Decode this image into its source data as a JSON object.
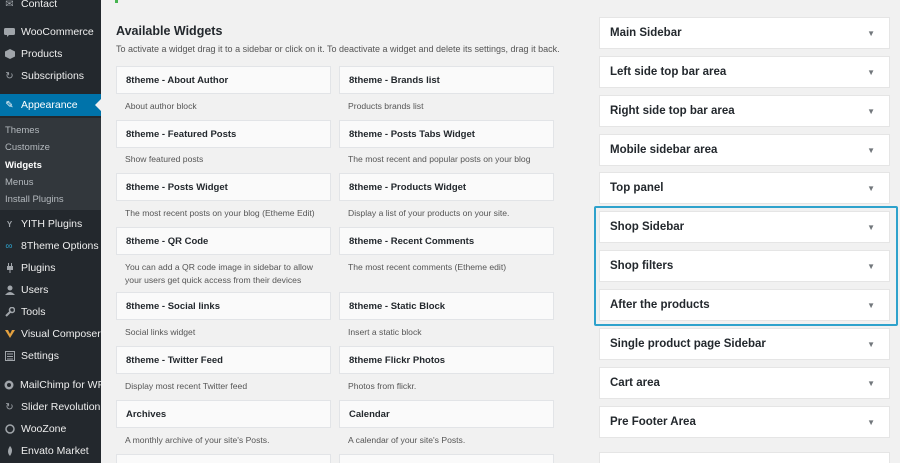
{
  "admin_menu": {
    "items": [
      {
        "label": "Contact",
        "icon": "envelope-icon"
      },
      {
        "label": "WooCommerce",
        "icon": "woocommerce-icon"
      },
      {
        "label": "Products",
        "icon": "box-icon"
      },
      {
        "label": "Subscriptions",
        "icon": "refresh-icon"
      },
      {
        "label": "Appearance",
        "icon": "paintbrush-icon"
      },
      {
        "label": "YITH Plugins",
        "icon": "yith-icon"
      },
      {
        "label": "8Theme Options",
        "icon": "infinity-icon"
      },
      {
        "label": "Plugins",
        "icon": "plug-icon"
      },
      {
        "label": "Users",
        "icon": "user-icon"
      },
      {
        "label": "Tools",
        "icon": "wrench-icon"
      },
      {
        "label": "Visual Composer",
        "icon": "vc-icon"
      },
      {
        "label": "Settings",
        "icon": "settings-icon"
      },
      {
        "label": "MailChimp for WP",
        "icon": "mailchimp-icon"
      },
      {
        "label": "Slider Revolution",
        "icon": "slider-icon"
      },
      {
        "label": "WooZone",
        "icon": "woozone-icon"
      },
      {
        "label": "Envato Market",
        "icon": "envato-icon"
      }
    ],
    "appearance_submenu": [
      "Themes",
      "Customize",
      "Widgets",
      "Menus",
      "Install Plugins"
    ],
    "active_color": "#0073aa"
  },
  "available_widgets": {
    "title": "Available Widgets",
    "description": "To activate a widget drag it to a sidebar or click on it. To deactivate a widget and delete its settings, drag it back.",
    "left": [
      {
        "name": "8theme - About Author",
        "desc": "About author block"
      },
      {
        "name": "8theme - Featured Posts",
        "desc": "Show featured posts"
      },
      {
        "name": "8theme - Posts Widget",
        "desc": "The most recent posts on your blog (Etheme Edit)"
      },
      {
        "name": "8theme - QR Code",
        "desc": "You can add a QR code image in sidebar to allow your users get quick access from their devices"
      },
      {
        "name": "8theme - Social links",
        "desc": "Social links widget"
      },
      {
        "name": "8theme - Twitter Feed",
        "desc": "Display most recent Twitter feed"
      },
      {
        "name": "Archives",
        "desc": "A monthly archive of your site's Posts."
      }
    ],
    "right": [
      {
        "name": "8theme - Brands list",
        "desc": "Products brands list"
      },
      {
        "name": "8theme - Posts Tabs Widget",
        "desc": "The most recent and popular posts on your blog"
      },
      {
        "name": "8theme - Products Widget",
        "desc": "Display a list of your products on your site."
      },
      {
        "name": "8theme - Recent Comments",
        "desc": "The most recent comments (Etheme edit)"
      },
      {
        "name": "8theme - Static Block",
        "desc": "Insert a static block"
      },
      {
        "name": "8theme Flickr Photos",
        "desc": "Photos from flickr."
      },
      {
        "name": "Calendar",
        "desc": "A calendar of your site's Posts."
      }
    ]
  },
  "widget_areas": [
    "Main Sidebar",
    "Left side top bar area",
    "Right side top bar area",
    "Mobile sidebar area",
    "Top panel",
    "Shop Sidebar",
    "Shop filters",
    "After the products",
    "Single product page Sidebar",
    "Cart area",
    "Pre Footer Area"
  ],
  "highlight_color": "#2ea2cc"
}
